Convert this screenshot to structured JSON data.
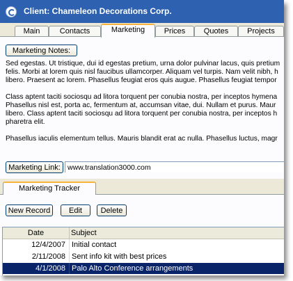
{
  "window": {
    "title": "Client: Chameleon Decorations Corp."
  },
  "tabs": [
    {
      "label": "Main",
      "active": false
    },
    {
      "label": "Contacts",
      "active": false
    },
    {
      "label": "Marketing",
      "active": true
    },
    {
      "label": "Prices",
      "active": false
    },
    {
      "label": "Quotes",
      "active": false
    },
    {
      "label": "Projects",
      "active": false
    }
  ],
  "marketing": {
    "notes_button": "Marketing Notes:",
    "notes_paragraphs": [
      [
        "Sed egestas. Ut tristique, dui id egestas pretium, urna dolor pulvinar lacus, quis pretium",
        "felis. Morbi at lorem quis nisl faucibus ullamcorper. Aliquam vel turpis. Nam velit nibh, h",
        "libero. Praesent ac lorem. Phasellus feugiat eros quis augue. Phasellus feugiat tempor"
      ],
      [
        "Class aptent taciti sociosqu ad litora torquent per conubia nostra, per inceptos hymena",
        "Phasellus nisl est, porta ac, fermentum at, accumsan vitae, dui. Nullam et purus. Maur",
        "libero. Class aptent taciti sociosqu ad litora torquent per conubia nostra, per inceptos h",
        "pharetra elit."
      ],
      [
        "Phasellus iaculis elementum tellus. Mauris blandit erat ac nulla. Phasellus luctus, magr"
      ]
    ],
    "link_button": "Marketing Link:",
    "link_value": "www.translation3000.com"
  },
  "tracker": {
    "tab_label": "Marketing Tracker",
    "buttons": {
      "new": "New Record",
      "edit": "Edit",
      "delete": "Delete"
    },
    "columns": [
      "Date",
      "Subject"
    ],
    "rows": [
      {
        "date": "12/4/2007",
        "subject": "Initial contact",
        "selected": false
      },
      {
        "date": "2/11/2008",
        "subject": "Sent info kit with best prices",
        "selected": false
      },
      {
        "date": "4/1/2008",
        "subject": "Palo Alto Conference arrangements",
        "selected": true
      }
    ]
  },
  "colors": {
    "titlebar": "#2e61b0",
    "selection": "#0a246a",
    "tab_highlight": "#f8b33b"
  }
}
